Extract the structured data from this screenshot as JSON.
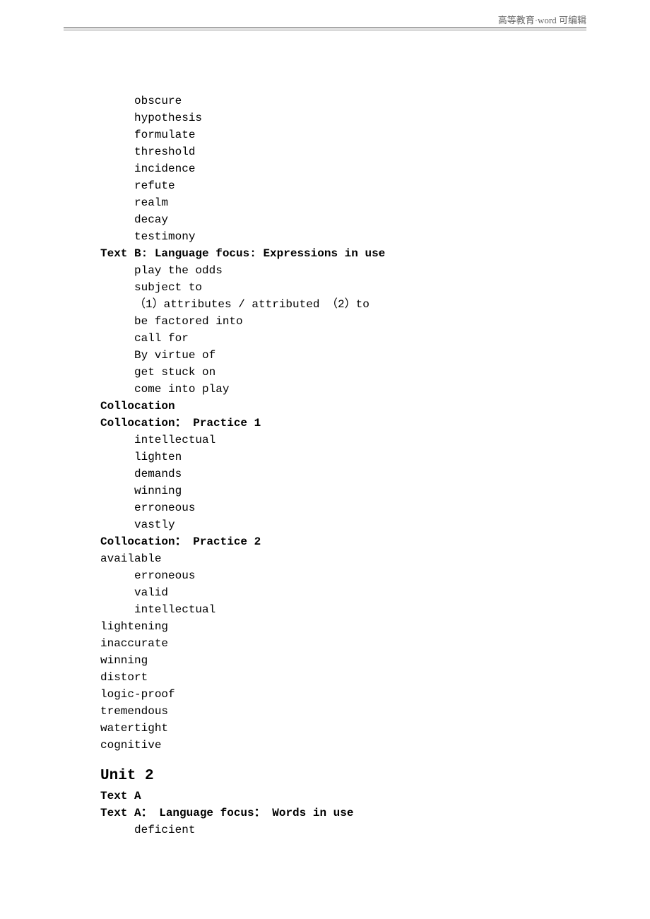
{
  "header": {
    "text": "高等教育·word 可编辑"
  },
  "section1": {
    "words": [
      "obscure",
      "hypothesis",
      "formulate",
      "threshold",
      "incidence",
      "refute",
      "realm",
      "decay",
      "testimony"
    ]
  },
  "section2": {
    "heading": "Text B: Language focus: Expressions in use",
    "items": [
      "play the odds",
      "subject to",
      "（1）attributes / attributed （2）to",
      "be factored into",
      "call for",
      "By virtue of",
      "get stuck on",
      "come into play"
    ]
  },
  "section3": {
    "heading": "Collocation",
    "sub1_heading": "Collocation： Practice 1",
    "sub1_items": [
      "intellectual",
      "lighten",
      "demands",
      "winning",
      "erroneous",
      "vastly"
    ],
    "sub2_heading": "Collocation： Practice 2",
    "sub2_noindent1": "available",
    "sub2_indent": [
      "erroneous",
      "valid",
      "intellectual"
    ],
    "sub2_noindent_rest": [
      "lightening",
      "inaccurate",
      "winning",
      "distort",
      "logic-proof",
      "tremendous",
      "watertight",
      "cognitive"
    ]
  },
  "section4": {
    "unit_heading": "Unit 2",
    "text_a": "Text A",
    "text_a_heading": "Text A： Language focus： Words in use",
    "items": [
      "deficient"
    ]
  }
}
